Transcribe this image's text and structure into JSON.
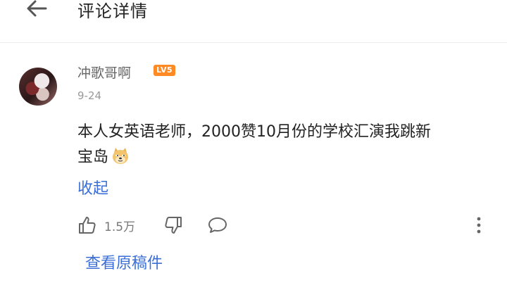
{
  "header": {
    "title": "评论详情"
  },
  "comment": {
    "username": "冲歌哥啊",
    "level": "LV5",
    "date": "9-24",
    "text": "本人女英语老师，2000赞10月份的学校汇演我跳新宝岛",
    "emoji_icon": "doge-emoji-icon",
    "collapse_label": "收起",
    "like_count": "1.5万",
    "view_original_label": "查看原稿件"
  },
  "colors": {
    "link": "#3b6fd6",
    "level_badge": "#ff8a24",
    "meta_text": "#999999"
  }
}
